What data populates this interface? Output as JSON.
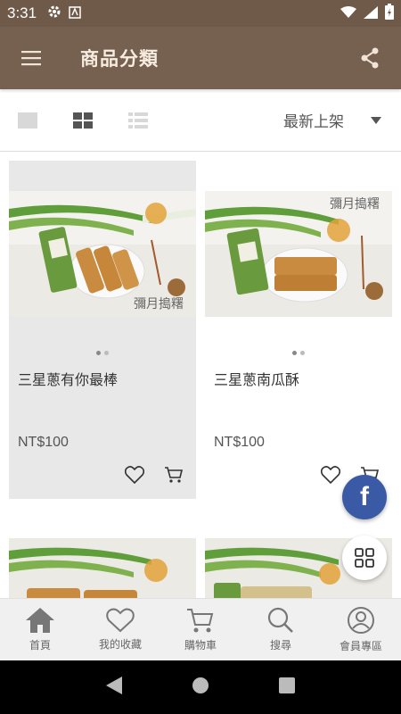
{
  "status_bar": {
    "time": "3:31"
  },
  "app_bar": {
    "title": "商品分類"
  },
  "toolbar": {
    "sort_label": "最新上架"
  },
  "products": [
    {
      "name": "三星蔥有你最棒",
      "price": "NT$100",
      "brand_stamp": "彌月搗糬"
    },
    {
      "name": "三星蔥南瓜酥",
      "price": "NT$100",
      "brand_stamp": "彌月搗糬"
    }
  ],
  "fab": {
    "facebook_label": "f"
  },
  "bottom_nav": [
    {
      "label": "首頁",
      "icon": "home-icon"
    },
    {
      "label": "我的收藏",
      "icon": "heart-icon"
    },
    {
      "label": "購物車",
      "icon": "cart-icon"
    },
    {
      "label": "搜尋",
      "icon": "search-icon"
    },
    {
      "label": "會員專區",
      "icon": "user-icon"
    }
  ],
  "colors": {
    "app_bar": "#76604f",
    "status_bar": "#6f5a4a",
    "title_text": "#f6ece0",
    "facebook": "#3b5aa5"
  }
}
